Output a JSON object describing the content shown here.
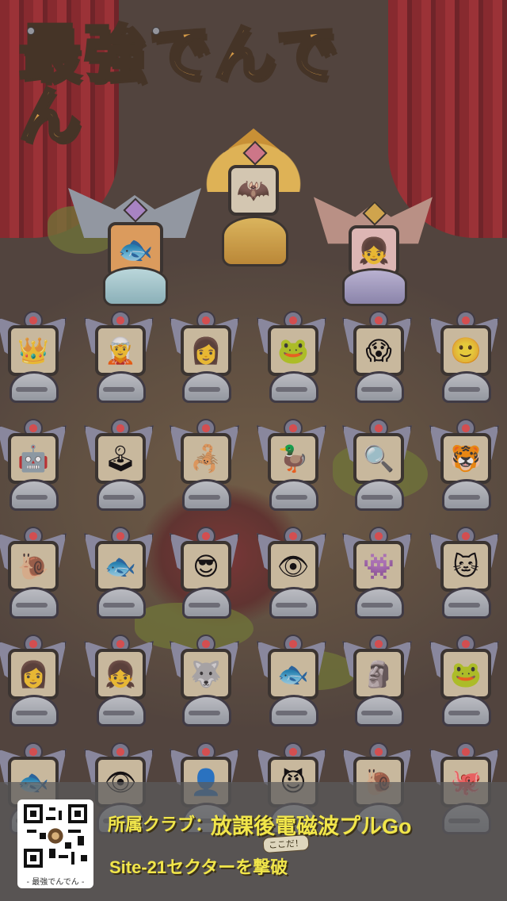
{
  "logo": {
    "title": "最強でんでん"
  },
  "podium": [
    {
      "rank": "silver",
      "face": "🐟"
    },
    {
      "rank": "gold",
      "face": "🦇"
    },
    {
      "rank": "bronze",
      "face": "👧"
    }
  ],
  "trophy_rows": [
    [
      "👑",
      "🧝",
      "👩",
      "🐸",
      "😱",
      "🙂"
    ],
    [
      "🤖",
      "🕹",
      "🦂",
      "🦆",
      "🔍",
      "🐯"
    ],
    [
      "🐌",
      "🐟",
      "😎",
      "👁",
      "👾",
      "🐱"
    ],
    [
      "👩",
      "👧",
      "🐺",
      "🐟",
      "🗿",
      "🐸"
    ],
    [
      "🐟",
      "👁",
      "👤",
      "😈",
      "🐌",
      "🐙"
    ]
  ],
  "footer": {
    "qr_caption": "- 最強でんでん -",
    "club_label": "所属クラブ：",
    "club_name": "放課後電磁波プルGo",
    "achievement": "Site-21セクターを撃破",
    "marker": "ここだ！"
  },
  "colors": {
    "accent": "#f1e64a",
    "curtain": "#a3282b",
    "gold": "#e9a73f"
  }
}
